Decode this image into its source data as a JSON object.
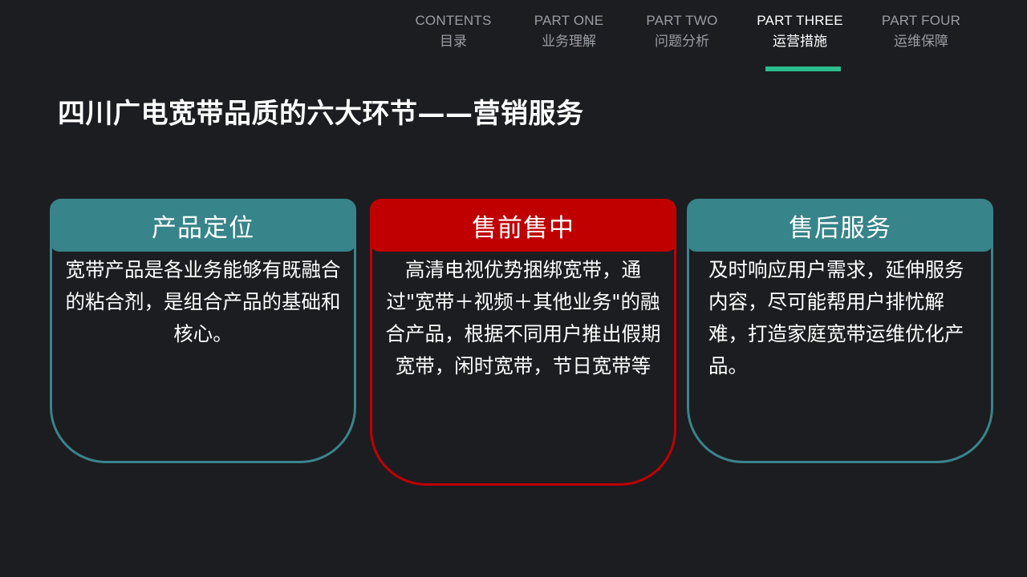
{
  "nav": {
    "items": [
      {
        "en": "CONTENTS",
        "zh": "目录"
      },
      {
        "en": "PART ONE",
        "zh": "业务理解"
      },
      {
        "en": "PART TWO",
        "zh": "问题分析"
      },
      {
        "en": "PART THREE",
        "zh": "运营措施"
      },
      {
        "en": "PART FOUR",
        "zh": "运维保障"
      }
    ],
    "active_index": 3
  },
  "title": "四川广电宽带品质的六大环节——营销服务",
  "cards": [
    {
      "heading": "产品定位",
      "text": "宽带产品是各业务能够有既融合的粘合剂，是组合产品的基础和核心。"
    },
    {
      "heading": "售前售中",
      "text": "高清电视优势捆绑宽带，通过\"宽带＋视频＋其他业务\"的融合产品，根据不同用户推出假期宽带，闲时宽带，节日宽带等"
    },
    {
      "heading": "售后服务",
      "text": "及时响应用户需求，延伸服务内容，尽可能帮用户排忧解难，打造家庭宽带运维优化产品。"
    }
  ],
  "colors": {
    "background": "#1b1d21",
    "teal": "#37848a",
    "red": "#c00000",
    "nav_active_underline": "#2bbd8e",
    "nav_inactive_text": "#9a9da3"
  }
}
